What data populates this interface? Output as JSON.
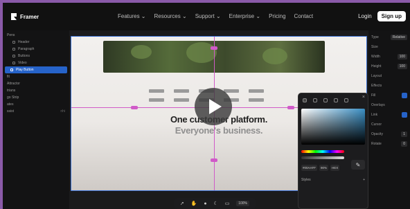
{
  "brand": {
    "name": "Framer"
  },
  "nav": {
    "items": [
      "Features",
      "Resources",
      "Support",
      "Enterprise",
      "Pricing",
      "Contact"
    ],
    "login": "Login",
    "signup": "Sign up"
  },
  "left_panel": {
    "items": [
      {
        "label": "Pens"
      },
      {
        "label": "Header"
      },
      {
        "label": "Paragraph"
      },
      {
        "label": "Buttons"
      },
      {
        "label": "Video"
      },
      {
        "label": "Play Button",
        "active": true
      },
      {
        "label": "fit"
      },
      {
        "label": "Attractor"
      },
      {
        "label": "trians"
      },
      {
        "label": "go Strip"
      },
      {
        "label": "ates"
      },
      {
        "label": "ssist",
        "right": "nhi"
      }
    ]
  },
  "preview": {
    "headline": "One customer platform.",
    "subline": "Everyone's business."
  },
  "color_picker": {
    "fields": [
      "#00AAFF",
      "90%",
      "HEX"
    ],
    "section": "Styles"
  },
  "right_panel": {
    "rows": [
      {
        "label": "Type",
        "value": "Relative"
      },
      {
        "label": "Size"
      },
      {
        "label": "Width",
        "value": "100"
      },
      {
        "label": "Height",
        "value": "100"
      },
      {
        "label": "Layout"
      },
      {
        "label": "Effects"
      },
      {
        "label": "Fill"
      },
      {
        "label": "Overlays"
      },
      {
        "label": "Link"
      },
      {
        "label": "Cursor"
      },
      {
        "label": "Opacity",
        "value": "1"
      },
      {
        "label": "Rotate",
        "value": "0"
      }
    ]
  },
  "toolbar": {
    "zoom": "100%"
  },
  "colors": {
    "frame_bg": "#8a5aa8",
    "accent_blue": "#2663c9",
    "guide_pink": "#d05ac8"
  }
}
